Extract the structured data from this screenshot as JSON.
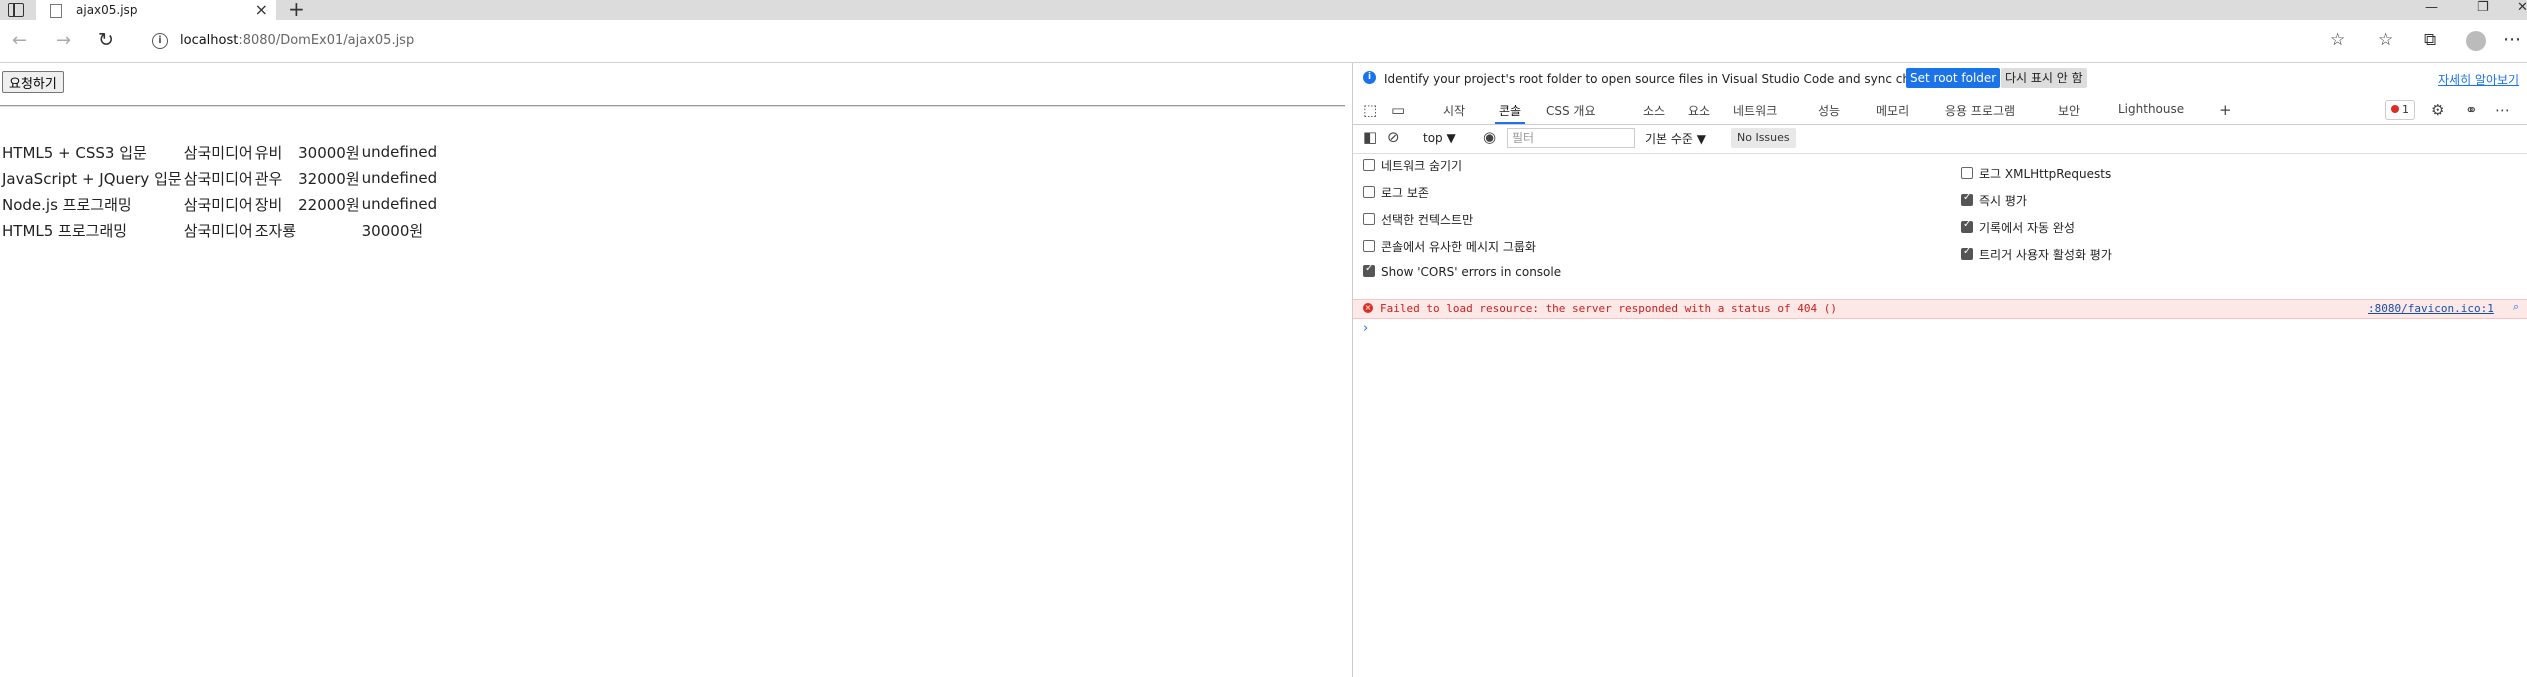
{
  "browser": {
    "tab_title": "ajax05.jsp",
    "tab_close": "×",
    "new_tab": "+",
    "url_host": "localhost",
    "url_rest": ":8080/DomEx01/ajax05.jsp",
    "window_controls": [
      "—",
      "❐",
      "✕"
    ],
    "nav_back": "←",
    "nav_forward": "→",
    "reload": "↻",
    "more": "⋯"
  },
  "page": {
    "request_button": "요청하기",
    "books": [
      {
        "title": "HTML5 + CSS3 입문",
        "publisher": "삼국미디어",
        "author": "유비",
        "price": "30000원",
        "extra": "undefined"
      },
      {
        "title": "JavaScript + JQuery 입문",
        "publisher": "삼국미디어",
        "author": "관우",
        "price": "32000원",
        "extra": "undefined"
      },
      {
        "title": "Node.js 프로그래밍",
        "publisher": "삼국미디어",
        "author": "장비",
        "price": "22000원",
        "extra": "undefined"
      },
      {
        "title": "HTML5 프로그래밍",
        "publisher": "삼국미디어",
        "author": "조자룡",
        "price": "",
        "extra": "30000원"
      }
    ]
  },
  "devtools": {
    "info_message": "Identify your project's root folder to open source files in Visual Studio Code and sync changes.",
    "set_root": "Set root folder",
    "dont_show": "다시 표시 안 함",
    "learn_more": "자세히 알아보기",
    "tabs": [
      "시작",
      "콘솔",
      "CSS 개요",
      "소스",
      "요소",
      "네트워크",
      "성능",
      "메모리",
      "응용 프로그램",
      "보안",
      "Lighthouse"
    ],
    "error_count": "1",
    "context": "top",
    "filter_placeholder": "필터",
    "levels": "기본 수준",
    "issues": "No Issues",
    "settings_left": [
      {
        "label": "네트워크 숨기기",
        "checked": false
      },
      {
        "label": "로그 보존",
        "checked": false
      },
      {
        "label": "선택한 컨텍스트만",
        "checked": false
      },
      {
        "label": "콘솔에서 유사한 메시지 그룹화",
        "checked": false
      },
      {
        "label": "Show 'CORS' errors in console",
        "checked": true
      }
    ],
    "settings_right": [
      {
        "label": "로그 XMLHttpRequests",
        "checked": false
      },
      {
        "label": "즉시 평가",
        "checked": true
      },
      {
        "label": "기록에서 자동 완성",
        "checked": true
      },
      {
        "label": "트리거 사용자 활성화 평가",
        "checked": true
      }
    ],
    "error_message": "Failed to load resource: the server responded with a status of 404 ()",
    "error_source": ":8080/favicon.ico:1",
    "prompt": "›"
  }
}
